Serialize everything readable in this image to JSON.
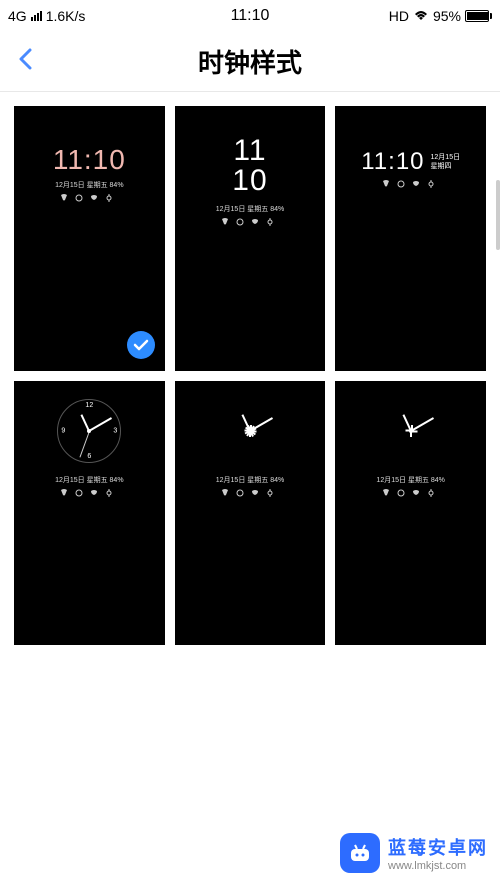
{
  "status": {
    "network": "4G",
    "speed": "1.6K/s",
    "time": "11:10",
    "hd": "HD",
    "battery_pct": "95%"
  },
  "nav": {
    "title": "时钟样式"
  },
  "preview": {
    "time": "11:10",
    "time_hh": "11",
    "time_mm": "10",
    "date_line": "12月15日 星期五 84%",
    "date_short": "12月15日",
    "weekday_alt": "星期四",
    "icons": "📞 💬 📧 🔔"
  },
  "tiles": [
    {
      "selected": true,
      "style": "digital-1",
      "name": "clock-style-1"
    },
    {
      "selected": false,
      "style": "digital-2",
      "name": "clock-style-2"
    },
    {
      "selected": false,
      "style": "digital-3",
      "name": "clock-style-3"
    },
    {
      "selected": false,
      "style": "analog-1",
      "name": "clock-style-4"
    },
    {
      "selected": false,
      "style": "analog-2",
      "name": "clock-style-5"
    },
    {
      "selected": false,
      "style": "analog-3",
      "name": "clock-style-6"
    }
  ],
  "watermark": {
    "title": "蓝莓安卓网",
    "url": "www.lmkjst.com"
  }
}
